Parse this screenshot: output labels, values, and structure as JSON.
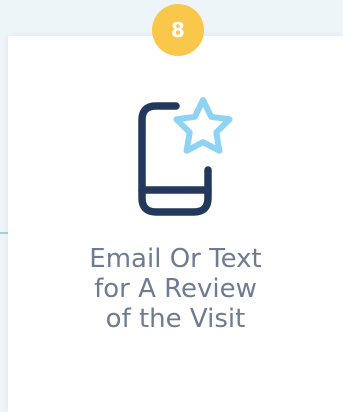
{
  "step": {
    "number": "8"
  },
  "card": {
    "icon": "phone-star-icon",
    "lines": [
      "Email Or Text",
      "for A Review",
      "of the Visit"
    ]
  },
  "colors": {
    "badge": "#f9c84a",
    "phone_outline": "#23395b",
    "star": "#8fd3f4",
    "text": "#6e7c93",
    "card_background": "#ffffff",
    "page_background": "#eef5f9"
  }
}
